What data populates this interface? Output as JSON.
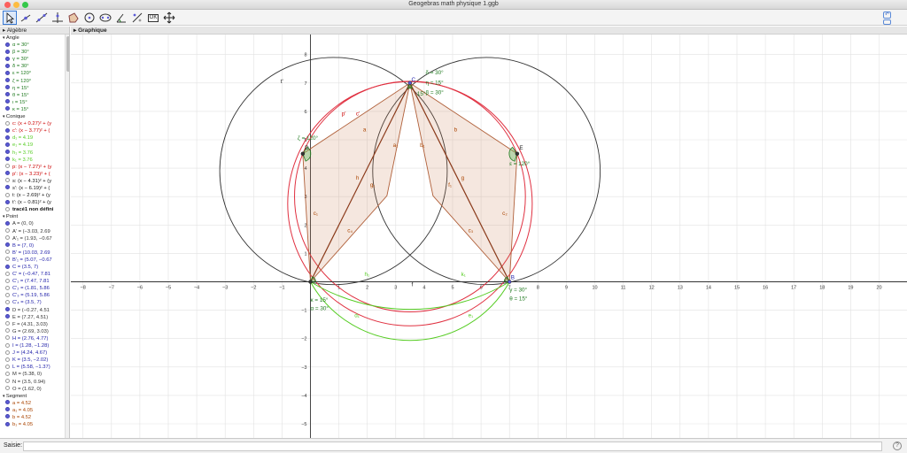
{
  "window": {
    "title": "Geogebras math physique 1.ggb"
  },
  "toolbar": {
    "tools": [
      {
        "id": "move",
        "icon": "arrow-cursor-icon",
        "selected": true
      },
      {
        "id": "point",
        "icon": "point-on-object-icon"
      },
      {
        "id": "line",
        "icon": "line-two-points-icon"
      },
      {
        "id": "perpendicular",
        "icon": "perpendicular-line-icon"
      },
      {
        "id": "polygon",
        "icon": "polygon-icon"
      },
      {
        "id": "circle",
        "icon": "circle-center-point-icon"
      },
      {
        "id": "conic",
        "icon": "ellipse-icon"
      },
      {
        "id": "angle",
        "icon": "angle-icon"
      },
      {
        "id": "reflect",
        "icon": "reflect-line-icon"
      },
      {
        "id": "slider",
        "icon": "slider-icon",
        "label": "OK"
      },
      {
        "id": "move-view",
        "icon": "move-graphics-view-icon"
      }
    ]
  },
  "algebra": {
    "title": "Algèbre",
    "groups": [
      {
        "name": "Angle",
        "items": [
          {
            "text": "α = 30°",
            "color": "#1f7a1f",
            "shown": true
          },
          {
            "text": "β = 30°",
            "color": "#1f7a1f",
            "shown": true
          },
          {
            "text": "γ = 30°",
            "color": "#1f7a1f",
            "shown": true
          },
          {
            "text": "δ = 30°",
            "color": "#1f7a1f",
            "shown": true
          },
          {
            "text": "ε = 120°",
            "color": "#1f7a1f",
            "shown": true
          },
          {
            "text": "ζ = 120°",
            "color": "#1f7a1f",
            "shown": true
          },
          {
            "text": "η = 15°",
            "color": "#1f7a1f",
            "shown": true
          },
          {
            "text": "θ = 15°",
            "color": "#1f7a1f",
            "shown": true
          },
          {
            "text": "ι = 15°",
            "color": "#1f7a1f",
            "shown": true
          },
          {
            "text": "κ = 15°",
            "color": "#1f7a1f",
            "shown": true
          }
        ]
      },
      {
        "name": "Conique",
        "items": [
          {
            "text": "c: (x + 0.27)² + (y",
            "color": "#cc0000",
            "shown": false
          },
          {
            "text": "c': (x − 3.77)² + (",
            "color": "#cc0000",
            "shown": true
          },
          {
            "text": "d₁ = 4.19",
            "color": "#55cc22",
            "shown": true
          },
          {
            "text": "e₁ = 4.19",
            "color": "#55cc22",
            "shown": true
          },
          {
            "text": "h₁ = 3.76",
            "color": "#55cc22",
            "shown": true
          },
          {
            "text": "k₁ = 3.76",
            "color": "#55cc22",
            "shown": true
          },
          {
            "text": "p: (x − 7.27)² + (y",
            "color": "#cc0000",
            "shown": false
          },
          {
            "text": "p': (x − 3.23)² + (",
            "color": "#cc0000",
            "shown": true
          },
          {
            "text": "s: (x − 4.31)² + (y",
            "color": "#111111",
            "shown": false
          },
          {
            "text": "s': (x − 6.19)² + (",
            "color": "#111111",
            "shown": true
          },
          {
            "text": "t: (x − 2.69)² + (y",
            "color": "#111111",
            "shown": false
          },
          {
            "text": "t': (x − 0.81)² + (y",
            "color": "#111111",
            "shown": true
          },
          {
            "text": "tracé1 non défini",
            "color": "#111111",
            "bold": true,
            "shown": false
          }
        ]
      },
      {
        "name": "Point",
        "items": [
          {
            "text": "A = (0, 0)",
            "color": "#333333",
            "shown": true
          },
          {
            "text": "A' = (−3.03, 2.69",
            "color": "#333333",
            "shown": false
          },
          {
            "text": "A'₁ = (1.93, −0.67",
            "color": "#333333",
            "shown": false
          },
          {
            "text": "B = (7, 0)",
            "color": "#2222aa",
            "shown": true
          },
          {
            "text": "B' = (10.03, 2.69",
            "color": "#2222aa",
            "shown": false
          },
          {
            "text": "B'₁ = (5.07, −0.67",
            "color": "#2222aa",
            "shown": false
          },
          {
            "text": "C = (3.5, 7)",
            "color": "#2222aa",
            "shown": true
          },
          {
            "text": "C' = (−0.47, 7.81",
            "color": "#2222aa",
            "shown": false
          },
          {
            "text": "C'₁ = (7.47, 7.81",
            "color": "#2222aa",
            "shown": false
          },
          {
            "text": "C'₂ = (1.81, 5.86",
            "color": "#2222aa",
            "shown": false
          },
          {
            "text": "C'₃ = (5.19, 5.86",
            "color": "#2222aa",
            "shown": false
          },
          {
            "text": "C'₄ = (3.5, 7)",
            "color": "#2222aa",
            "shown": false
          },
          {
            "text": "D = (−0.27, 4.51",
            "color": "#333333",
            "shown": true
          },
          {
            "text": "E = (7.27, 4.51)",
            "color": "#333333",
            "shown": true
          },
          {
            "text": "F = (4.31, 3.03)",
            "color": "#333333",
            "shown": false
          },
          {
            "text": "G = (2.69, 3.03)",
            "color": "#333333",
            "shown": false
          },
          {
            "text": "H = (2.76, 4.77)",
            "color": "#2222aa",
            "shown": false
          },
          {
            "text": "I = (1.28, −1.28)",
            "color": "#2222aa",
            "shown": false
          },
          {
            "text": "J = (4.24, 4.67)",
            "color": "#2222aa",
            "shown": false
          },
          {
            "text": "K = (3.5, −2.02)",
            "color": "#2222aa",
            "shown": false
          },
          {
            "text": "L = (5.58, −1.37)",
            "color": "#2222aa",
            "shown": false
          },
          {
            "text": "M = (5.38, 0)",
            "color": "#333333",
            "shown": false
          },
          {
            "text": "N = (3.5, 0.94)",
            "color": "#333333",
            "shown": false
          },
          {
            "text": "O = (1.62, 0)",
            "color": "#333333",
            "shown": false
          }
        ]
      },
      {
        "name": "Segment",
        "items": [
          {
            "text": "a = 4.52",
            "color": "#aa4400",
            "shown": true
          },
          {
            "text": "a₁ = 4.05",
            "color": "#aa4400",
            "shown": true
          },
          {
            "text": "b = 4.52",
            "color": "#aa4400",
            "shown": true
          },
          {
            "text": "b₁ = 4.05",
            "color": "#aa4400",
            "shown": true
          }
        ]
      }
    ]
  },
  "graphics": {
    "title": "Graphique",
    "x_ticks": [
      "−8",
      "−7",
      "−6",
      "−5",
      "−4",
      "−3",
      "−2",
      "−1",
      "0",
      "1",
      "2",
      "3",
      "4",
      "5",
      "6",
      "7",
      "8",
      "9",
      "10",
      "11",
      "12",
      "13",
      "14",
      "15",
      "16",
      "17",
      "18",
      "19",
      "20"
    ],
    "y_ticks": [
      "8",
      "7",
      "6",
      "5",
      "4",
      "3",
      "2",
      "1",
      "0",
      "−1",
      "−2",
      "−3",
      "−4",
      "−5"
    ],
    "labels": [
      {
        "text": "t'",
        "x": -1.05,
        "y": 7.0,
        "color": "#222222"
      },
      {
        "text": "δ = 30°",
        "x": 4.05,
        "y": 7.3,
        "color": "#1f7a1f"
      },
      {
        "text": "η = 15°",
        "x": 4.05,
        "y": 6.95,
        "color": "#1f7a1f"
      },
      {
        "text": "β = 30°",
        "x": 4.05,
        "y": 6.6,
        "color": "#1f7a1f"
      },
      {
        "text": "C",
        "x": 3.55,
        "y": 7.05,
        "color": "#2222aa"
      },
      {
        "text": "15°",
        "x": 3.75,
        "y": 6.55,
        "color": "#1f7a1f"
      },
      {
        "text": "p'",
        "x": 1.1,
        "y": 5.85,
        "color": "#cc0000"
      },
      {
        "text": "c'",
        "x": 1.6,
        "y": 5.85,
        "color": "#cc0000"
      },
      {
        "text": "a",
        "x": 1.85,
        "y": 5.3,
        "color": "#aa4400"
      },
      {
        "text": "b",
        "x": 5.05,
        "y": 5.3,
        "color": "#aa4400"
      },
      {
        "text": "a₁",
        "x": 2.9,
        "y": 4.75,
        "color": "#aa4400"
      },
      {
        "text": "b₁",
        "x": 3.85,
        "y": 4.75,
        "color": "#aa4400"
      },
      {
        "text": "ζ = 120°",
        "x": -0.45,
        "y": 5.0,
        "color": "#1f7a1f"
      },
      {
        "text": "D",
        "x": -0.2,
        "y": 4.65,
        "color": "#222222"
      },
      {
        "text": "E",
        "x": 7.35,
        "y": 4.65,
        "color": "#222222"
      },
      {
        "text": "ε = 120°",
        "x": 7.0,
        "y": 4.1,
        "color": "#1f7a1f"
      },
      {
        "text": "h",
        "x": 1.6,
        "y": 3.6,
        "color": "#aa4400"
      },
      {
        "text": "g",
        "x": 5.3,
        "y": 3.6,
        "color": "#aa4400"
      },
      {
        "text": "g₁",
        "x": 2.1,
        "y": 3.35,
        "color": "#aa4400"
      },
      {
        "text": "f₁",
        "x": 4.85,
        "y": 3.35,
        "color": "#aa4400"
      },
      {
        "text": "c₁",
        "x": 0.1,
        "y": 2.35,
        "color": "#aa4400"
      },
      {
        "text": "c₂",
        "x": 6.75,
        "y": 2.35,
        "color": "#aa4400"
      },
      {
        "text": "c₄",
        "x": 1.3,
        "y": 1.75,
        "color": "#aa4400"
      },
      {
        "text": "c₃",
        "x": 5.55,
        "y": 1.75,
        "color": "#aa4400"
      },
      {
        "text": "h₁",
        "x": 1.9,
        "y": 0.2,
        "color": "#55cc22"
      },
      {
        "text": "k₁",
        "x": 5.3,
        "y": 0.2,
        "color": "#55cc22"
      },
      {
        "text": "f",
        "x": 3.55,
        "y": -0.15,
        "color": "#222222"
      },
      {
        "text": "B",
        "x": 7.05,
        "y": 0.1,
        "color": "#2222aa"
      },
      {
        "text": "γ = 30°",
        "x": 7.0,
        "y": -0.35,
        "color": "#1f7a1f"
      },
      {
        "text": "θ = 15°",
        "x": 7.0,
        "y": -0.65,
        "color": "#1f7a1f"
      },
      {
        "text": "κ = 15°",
        "x": 0.0,
        "y": -0.7,
        "color": "#1f7a1f"
      },
      {
        "text": "α = 30°",
        "x": 0.0,
        "y": -1.0,
        "color": "#1f7a1f"
      },
      {
        "text": "d₁",
        "x": 1.55,
        "y": -1.25,
        "color": "#55cc22"
      },
      {
        "text": "e₁",
        "x": 5.55,
        "y": -1.25,
        "color": "#55cc22"
      }
    ]
  },
  "input": {
    "label": "Saisie:",
    "value": "",
    "placeholder": ""
  }
}
